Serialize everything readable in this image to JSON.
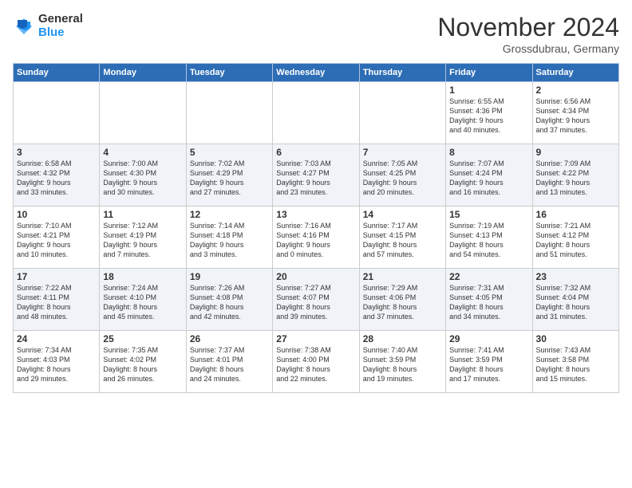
{
  "logo": {
    "general": "General",
    "blue": "Blue"
  },
  "header": {
    "month_title": "November 2024",
    "location": "Grossdubrau, Germany"
  },
  "weekdays": [
    "Sunday",
    "Monday",
    "Tuesday",
    "Wednesday",
    "Thursday",
    "Friday",
    "Saturday"
  ],
  "weeks": [
    [
      {
        "day": "",
        "info": ""
      },
      {
        "day": "",
        "info": ""
      },
      {
        "day": "",
        "info": ""
      },
      {
        "day": "",
        "info": ""
      },
      {
        "day": "",
        "info": ""
      },
      {
        "day": "1",
        "info": "Sunrise: 6:55 AM\nSunset: 4:36 PM\nDaylight: 9 hours\nand 40 minutes."
      },
      {
        "day": "2",
        "info": "Sunrise: 6:56 AM\nSunset: 4:34 PM\nDaylight: 9 hours\nand 37 minutes."
      }
    ],
    [
      {
        "day": "3",
        "info": "Sunrise: 6:58 AM\nSunset: 4:32 PM\nDaylight: 9 hours\nand 33 minutes."
      },
      {
        "day": "4",
        "info": "Sunrise: 7:00 AM\nSunset: 4:30 PM\nDaylight: 9 hours\nand 30 minutes."
      },
      {
        "day": "5",
        "info": "Sunrise: 7:02 AM\nSunset: 4:29 PM\nDaylight: 9 hours\nand 27 minutes."
      },
      {
        "day": "6",
        "info": "Sunrise: 7:03 AM\nSunset: 4:27 PM\nDaylight: 9 hours\nand 23 minutes."
      },
      {
        "day": "7",
        "info": "Sunrise: 7:05 AM\nSunset: 4:25 PM\nDaylight: 9 hours\nand 20 minutes."
      },
      {
        "day": "8",
        "info": "Sunrise: 7:07 AM\nSunset: 4:24 PM\nDaylight: 9 hours\nand 16 minutes."
      },
      {
        "day": "9",
        "info": "Sunrise: 7:09 AM\nSunset: 4:22 PM\nDaylight: 9 hours\nand 13 minutes."
      }
    ],
    [
      {
        "day": "10",
        "info": "Sunrise: 7:10 AM\nSunset: 4:21 PM\nDaylight: 9 hours\nand 10 minutes."
      },
      {
        "day": "11",
        "info": "Sunrise: 7:12 AM\nSunset: 4:19 PM\nDaylight: 9 hours\nand 7 minutes."
      },
      {
        "day": "12",
        "info": "Sunrise: 7:14 AM\nSunset: 4:18 PM\nDaylight: 9 hours\nand 3 minutes."
      },
      {
        "day": "13",
        "info": "Sunrise: 7:16 AM\nSunset: 4:16 PM\nDaylight: 9 hours\nand 0 minutes."
      },
      {
        "day": "14",
        "info": "Sunrise: 7:17 AM\nSunset: 4:15 PM\nDaylight: 8 hours\nand 57 minutes."
      },
      {
        "day": "15",
        "info": "Sunrise: 7:19 AM\nSunset: 4:13 PM\nDaylight: 8 hours\nand 54 minutes."
      },
      {
        "day": "16",
        "info": "Sunrise: 7:21 AM\nSunset: 4:12 PM\nDaylight: 8 hours\nand 51 minutes."
      }
    ],
    [
      {
        "day": "17",
        "info": "Sunrise: 7:22 AM\nSunset: 4:11 PM\nDaylight: 8 hours\nand 48 minutes."
      },
      {
        "day": "18",
        "info": "Sunrise: 7:24 AM\nSunset: 4:10 PM\nDaylight: 8 hours\nand 45 minutes."
      },
      {
        "day": "19",
        "info": "Sunrise: 7:26 AM\nSunset: 4:08 PM\nDaylight: 8 hours\nand 42 minutes."
      },
      {
        "day": "20",
        "info": "Sunrise: 7:27 AM\nSunset: 4:07 PM\nDaylight: 8 hours\nand 39 minutes."
      },
      {
        "day": "21",
        "info": "Sunrise: 7:29 AM\nSunset: 4:06 PM\nDaylight: 8 hours\nand 37 minutes."
      },
      {
        "day": "22",
        "info": "Sunrise: 7:31 AM\nSunset: 4:05 PM\nDaylight: 8 hours\nand 34 minutes."
      },
      {
        "day": "23",
        "info": "Sunrise: 7:32 AM\nSunset: 4:04 PM\nDaylight: 8 hours\nand 31 minutes."
      }
    ],
    [
      {
        "day": "24",
        "info": "Sunrise: 7:34 AM\nSunset: 4:03 PM\nDaylight: 8 hours\nand 29 minutes."
      },
      {
        "day": "25",
        "info": "Sunrise: 7:35 AM\nSunset: 4:02 PM\nDaylight: 8 hours\nand 26 minutes."
      },
      {
        "day": "26",
        "info": "Sunrise: 7:37 AM\nSunset: 4:01 PM\nDaylight: 8 hours\nand 24 minutes."
      },
      {
        "day": "27",
        "info": "Sunrise: 7:38 AM\nSunset: 4:00 PM\nDaylight: 8 hours\nand 22 minutes."
      },
      {
        "day": "28",
        "info": "Sunrise: 7:40 AM\nSunset: 3:59 PM\nDaylight: 8 hours\nand 19 minutes."
      },
      {
        "day": "29",
        "info": "Sunrise: 7:41 AM\nSunset: 3:59 PM\nDaylight: 8 hours\nand 17 minutes."
      },
      {
        "day": "30",
        "info": "Sunrise: 7:43 AM\nSunset: 3:58 PM\nDaylight: 8 hours\nand 15 minutes."
      }
    ]
  ]
}
